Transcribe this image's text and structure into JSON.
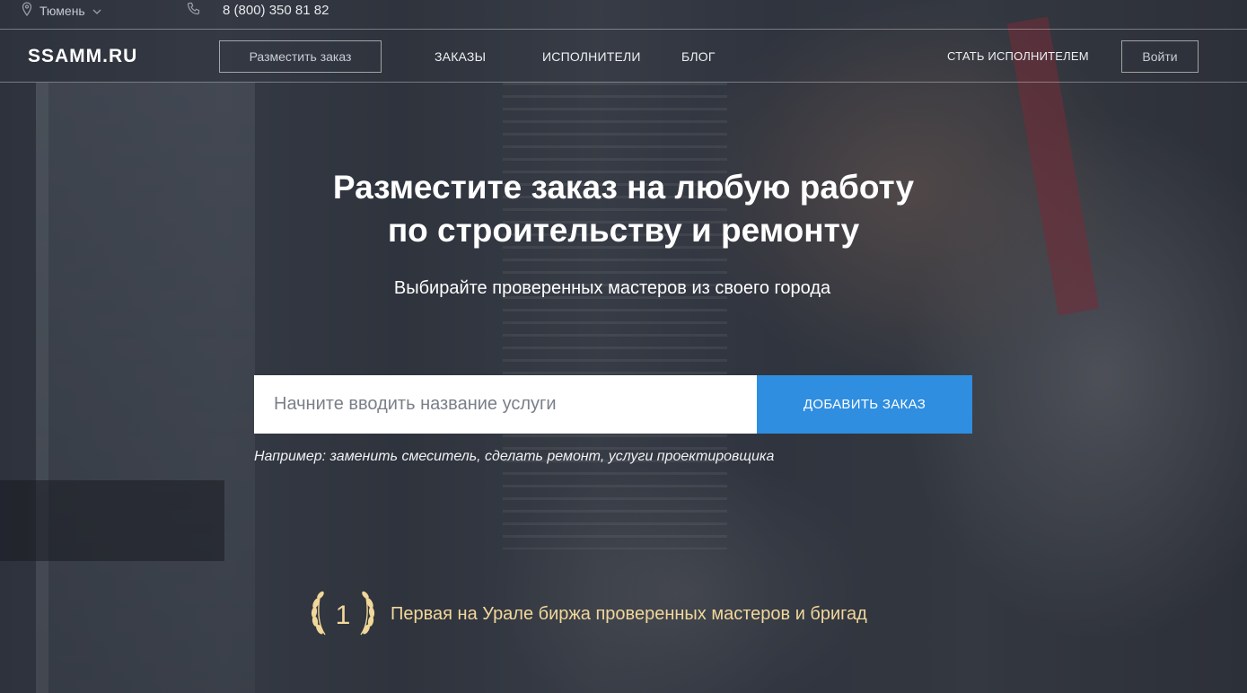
{
  "topbar": {
    "city": "Тюмень",
    "phone": "8 (800) 350 81 82"
  },
  "nav": {
    "logo": "SSAMM.RU",
    "place_order": "Разместить заказ",
    "links": [
      "ЗАКАЗЫ",
      "ИСПОЛНИТЕЛИ",
      "БЛОГ"
    ],
    "become_performer": "СТАТЬ ИСПОЛНИТЕЛЕМ",
    "login": "Войти"
  },
  "hero": {
    "title_line1": "Разместите заказ на любую работу",
    "title_line2": "по строительству и ремонту",
    "subtitle": "Выбирайте проверенных мастеров из своего города"
  },
  "search": {
    "placeholder": "Начните вводить название услуги",
    "button": "ДОБАВИТЬ ЗАКАЗ",
    "example": "Например: заменить смеситель, сделать ремонт, услуги проектировщика"
  },
  "badge": {
    "number": "1",
    "text": "Первая на Урале биржа проверенных мастеров и бригад"
  },
  "colors": {
    "accent": "#2f8ee0",
    "badge_text": "#f1d79a"
  },
  "icons": {
    "city": "location-pin-icon",
    "phone": "phone-icon",
    "city_dropdown": "chevron-down-icon",
    "badge": "laurel-wreath-icon"
  }
}
